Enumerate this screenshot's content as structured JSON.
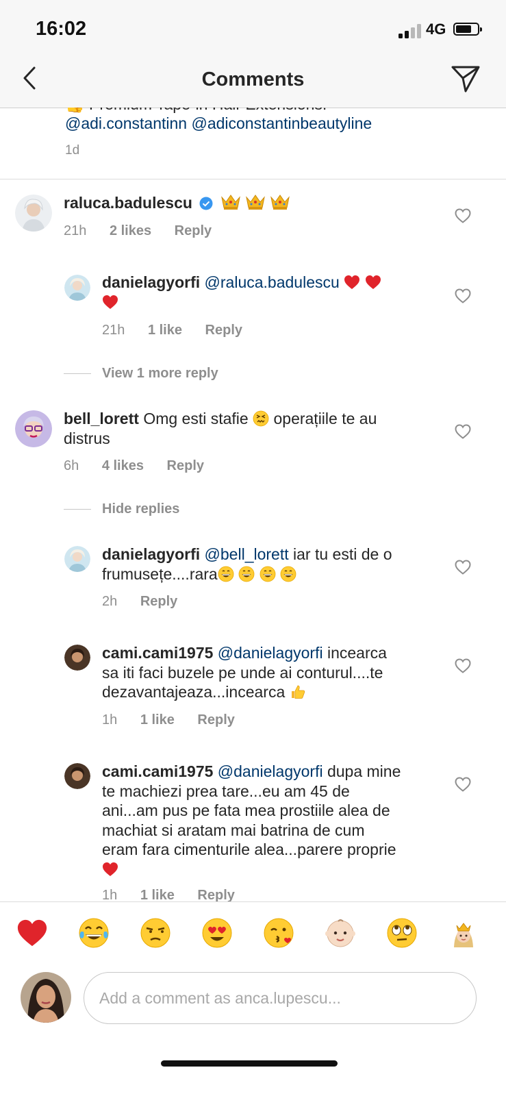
{
  "status": {
    "time": "16:02",
    "network": "4G"
  },
  "nav": {
    "title": "Comments"
  },
  "caption": {
    "cut_line": "👍 Premium Tape-in Hair Extensions:",
    "mention1": "@adi.constantinn",
    "mention2": "@adiconstantinbeautyline",
    "time": "1d"
  },
  "comments": [
    {
      "username": "raluca.badulescu",
      "verified": true,
      "emojis": "👑👑👑",
      "time": "21h",
      "likes": "2 likes",
      "reply": "Reply"
    },
    {
      "username": "danielagyorfi",
      "mention": "@raluca.badulescu",
      "time": "21h",
      "likes": "1 like",
      "reply": "Reply"
    },
    {
      "username": "bell_lorett",
      "text1": "Omg esti stafie",
      "text2": "operațiile te au",
      "text3": "distrus",
      "time": "6h",
      "likes": "4 likes",
      "reply": "Reply"
    },
    {
      "username": "danielagyorfi",
      "mention": "@bell_lorett",
      "text1": "iar tu esti de o",
      "text2": "frumusețe....rara",
      "time": "2h",
      "reply": "Reply"
    },
    {
      "username": "cami.cami1975",
      "mention": "@danielagyorfi",
      "text1": "incearca",
      "text2": "sa iti faci buzele pe unde ai conturul....te",
      "text3": "dezavantajeaza...incearca",
      "time": "1h",
      "likes": "1 like",
      "reply": "Reply"
    },
    {
      "username": "cami.cami1975",
      "mention": "@danielagyorfi",
      "text1": "dupa mine",
      "text2": "te machiezi prea tare...eu am 45 de",
      "text3": "ani...am pus pe fata mea prostiile alea de",
      "text4": "machiat si aratam mai batrina de cum",
      "text5": "eram fara cimenturile alea...parere proprie",
      "time": "1h",
      "likes": "1 like",
      "reply": "Reply"
    }
  ],
  "threads": {
    "view_more": "View 1 more reply",
    "hide": "Hide replies"
  },
  "emoji_bar": [
    "heart",
    "tears-of-joy",
    "unamused",
    "heart-eyes",
    "kiss",
    "baby",
    "eye-roll",
    "princess"
  ],
  "composer": {
    "placeholder": "Add a comment as anca.lupescu..."
  },
  "colors": {
    "mention": "#00376b",
    "meta": "#8e8e8e",
    "text": "#262626",
    "verified": "#3897f0",
    "heart_red": "#e0242b"
  }
}
